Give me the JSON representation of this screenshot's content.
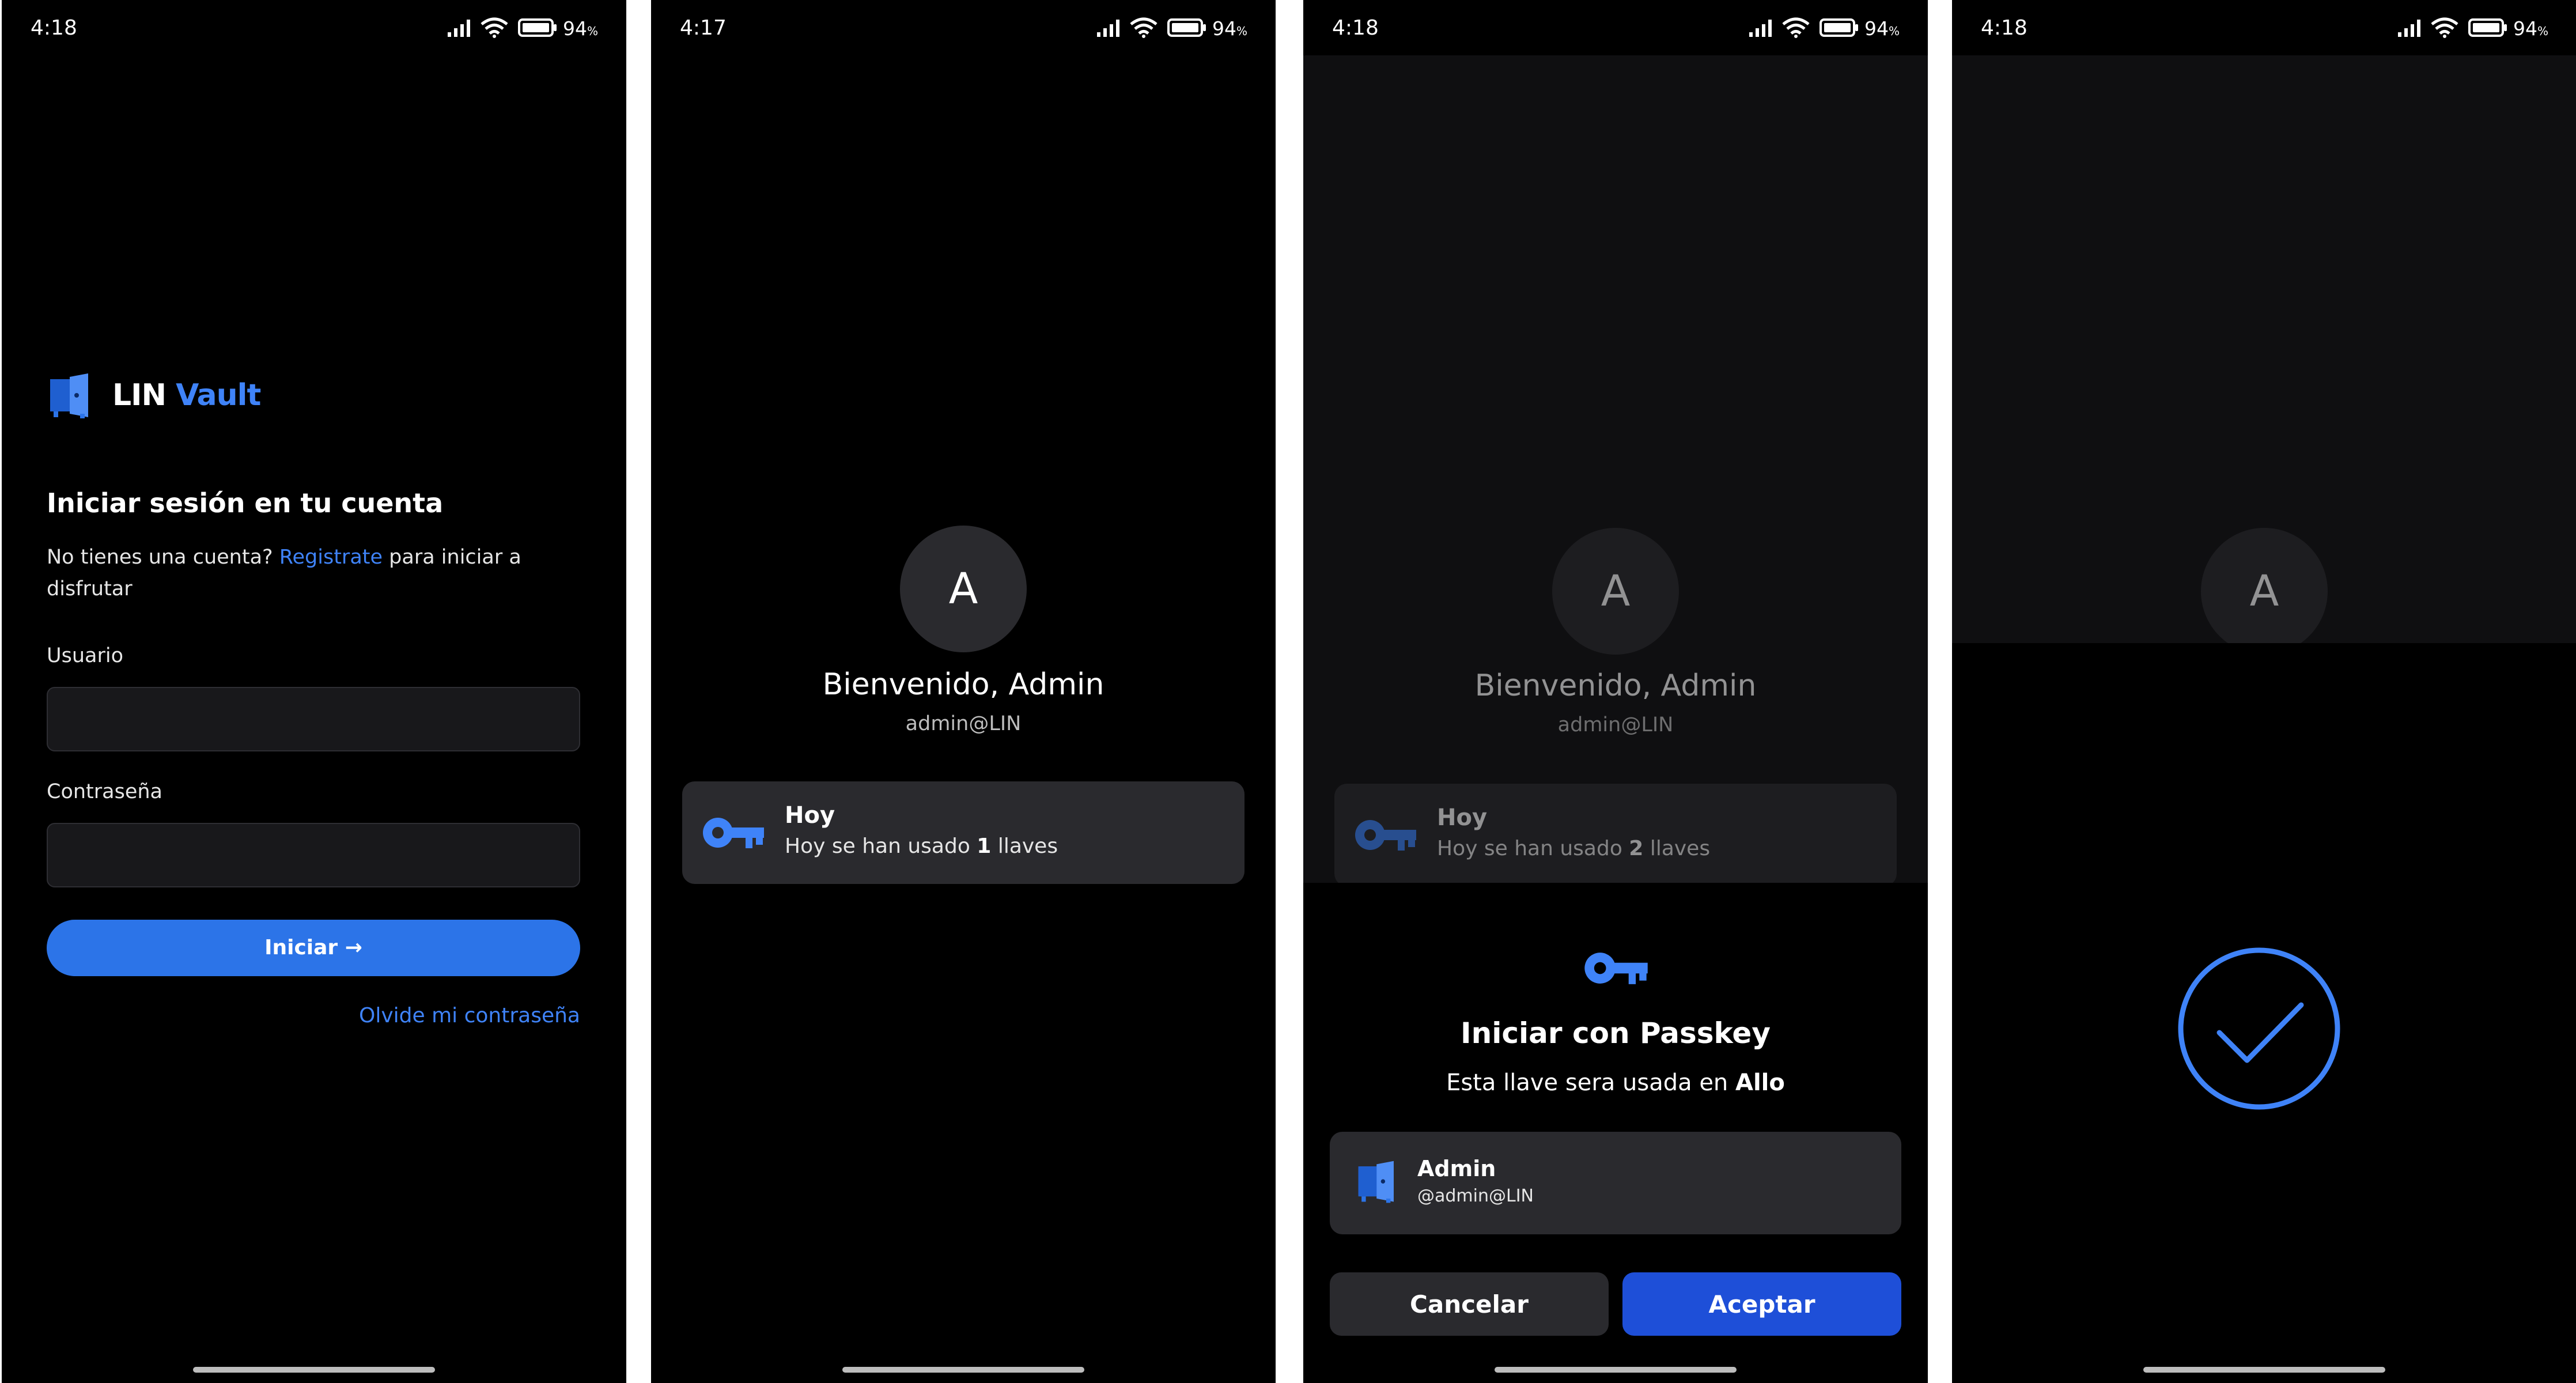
{
  "colors": {
    "accent": "#3f83f8",
    "primary_button": "#2c74e8",
    "accept_button": "#1e4fd8",
    "card": "#2a2a2e",
    "background": "#000000"
  },
  "screens": [
    {
      "status": {
        "time": "4:18",
        "battery": "94",
        "battery_unit": "%"
      }
    },
    {
      "status": {
        "time": "4:17",
        "battery": "94",
        "battery_unit": "%"
      }
    },
    {
      "status": {
        "time": "4:18",
        "battery": "94",
        "battery_unit": "%"
      }
    },
    {
      "status": {
        "time": "4:18",
        "battery": "94",
        "battery_unit": "%"
      }
    }
  ],
  "login": {
    "logo_part1": "LIN",
    "logo_part2": "Vault",
    "title": "Iniciar sesión en tu cuenta",
    "subtitle_prefix": "No tienes una cuenta?",
    "register_link": "Registrate",
    "subtitle_suffix": "para iniciar a disfrutar",
    "user_label": "Usuario",
    "user_value": "",
    "password_label": "Contraseña",
    "password_value": "",
    "submit_label": "Iniciar →",
    "forgot_link": "Olvide mi contraseña"
  },
  "welcome": {
    "avatar_letter": "A",
    "greeting": "Bienvenido, Admin",
    "handle": "admin@LIN",
    "card_title": "Hoy",
    "card_prefix": "Hoy se han usado",
    "card_count": "1",
    "card_suffix": "llaves"
  },
  "passkey": {
    "avatar_letter": "A",
    "greeting": "Bienvenido, Admin",
    "handle": "admin@LIN",
    "card_title": "Hoy",
    "card_prefix": "Hoy se han usado",
    "card_count": "2",
    "card_suffix": "llaves",
    "sheet_title": "Iniciar con Passkey",
    "sheet_subtitle_prefix": "Esta llave sera usada en",
    "sheet_subtitle_app": "Allo",
    "account_name": "Admin",
    "account_handle": "@admin@LIN",
    "cancel_label": "Cancelar",
    "accept_label": "Aceptar"
  },
  "success": {
    "avatar_letter": "A",
    "icon": "checkmark-circle-icon"
  }
}
